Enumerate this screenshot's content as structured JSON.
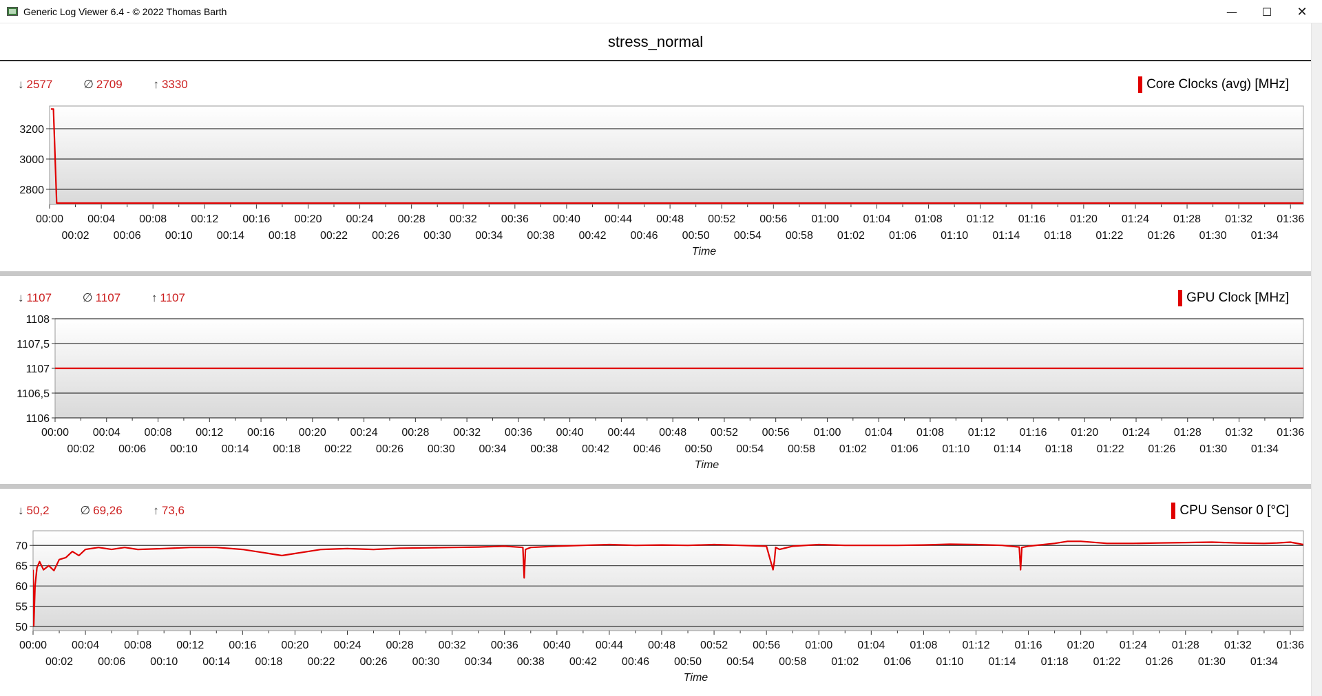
{
  "window": {
    "title": "Generic Log Viewer 6.4 - © 2022 Thomas Barth",
    "min_glyph": "—",
    "max_glyph": "☐",
    "close_glyph": "✕"
  },
  "header": {
    "title": "stress_normal"
  },
  "time_ticks_top": [
    "00:00",
    "00:04",
    "00:08",
    "00:12",
    "00:16",
    "00:20",
    "00:24",
    "00:28",
    "00:32",
    "00:36",
    "00:40",
    "00:44",
    "00:48",
    "00:52",
    "00:56",
    "01:00",
    "01:04",
    "01:08",
    "01:12",
    "01:16",
    "01:20",
    "01:24",
    "01:28",
    "01:32",
    "01:36"
  ],
  "time_ticks_bottom": [
    "00:02",
    "00:06",
    "00:10",
    "00:14",
    "00:18",
    "00:22",
    "00:26",
    "00:30",
    "00:34",
    "00:38",
    "00:42",
    "00:46",
    "00:50",
    "00:54",
    "00:58",
    "01:02",
    "01:06",
    "01:10",
    "01:14",
    "01:18",
    "01:22",
    "01:26",
    "01:30",
    "01:34"
  ],
  "colors": {
    "series": "#e00000",
    "stats": "#cc1f1f",
    "grid": "#3a3a3a"
  },
  "chart_data": [
    {
      "type": "line",
      "legend": "Core Clocks (avg) [MHz]",
      "xlabel": "Time",
      "xlim_minutes": [
        0,
        97
      ],
      "ylim": [
        2700,
        3350
      ],
      "y_ticks": [
        3200,
        3000,
        2800
      ],
      "y_tick_labels": [
        "3200",
        "3000",
        "2800"
      ],
      "stats": {
        "min": "2577",
        "avg": "2709",
        "max": "3330"
      },
      "series": [
        {
          "x_minutes": [
            0.1,
            0.3,
            0.55,
            97
          ],
          "values": [
            3330,
            3330,
            2709,
            2709
          ]
        }
      ]
    },
    {
      "type": "line",
      "legend": "GPU Clock [MHz]",
      "xlabel": "Time",
      "xlim_minutes": [
        0,
        97
      ],
      "ylim": [
        1106,
        1108
      ],
      "y_ticks": [
        1108,
        1107.5,
        1107,
        1106.5,
        1106
      ],
      "y_tick_labels": [
        "1108",
        "1107,5",
        "1107",
        "1106,5",
        "1106"
      ],
      "stats": {
        "min": "1107",
        "avg": "1107",
        "max": "1107"
      },
      "series": [
        {
          "x_minutes": [
            0,
            97
          ],
          "values": [
            1107,
            1107
          ]
        }
      ]
    },
    {
      "type": "line",
      "legend": "CPU Sensor 0 [°C]",
      "xlabel": "Time",
      "xlim_minutes": [
        0,
        97
      ],
      "ylim": [
        49,
        73.6
      ],
      "y_ticks": [
        70,
        65,
        60,
        55,
        50
      ],
      "y_tick_labels": [
        "70",
        "65",
        "60",
        "55",
        "50"
      ],
      "stats": {
        "min": "50,2",
        "avg": "69,26",
        "max": "73,6"
      },
      "series": [
        {
          "x_minutes": [
            0.0,
            0.05,
            0.15,
            0.3,
            0.5,
            0.8,
            1.2,
            1.6,
            2.0,
            2.5,
            3.0,
            3.5,
            4.0,
            5.0,
            6.0,
            7.0,
            8.0,
            10.0,
            12.0,
            14.0,
            16.0,
            18.0,
            19.0,
            20.0,
            21.0,
            22.0,
            24.0,
            26.0,
            28.0,
            30.0,
            32.0,
            34.0,
            36.0,
            37.4,
            37.5,
            37.6,
            38.0,
            40.0,
            42.0,
            44.0,
            46.0,
            48.0,
            50.0,
            52.0,
            54.0,
            56.0,
            56.5,
            56.6,
            56.7,
            57.0,
            58.0,
            60.0,
            62.0,
            64.0,
            66.0,
            68.0,
            70.0,
            72.0,
            74.0,
            75.3,
            75.4,
            75.5,
            76.0,
            78.0,
            79.0,
            80.0,
            82.0,
            84.0,
            86.0,
            88.0,
            90.0,
            92.0,
            94.0,
            95.0,
            96.0,
            97.0
          ],
          "values": [
            64.0,
            50.2,
            60.0,
            64.5,
            66.0,
            64.0,
            65.0,
            63.8,
            66.5,
            67.0,
            68.5,
            67.5,
            69.0,
            69.5,
            69.0,
            69.5,
            69.0,
            69.2,
            69.5,
            69.5,
            69.0,
            68.0,
            67.5,
            68.0,
            68.5,
            69.0,
            69.2,
            69.0,
            69.3,
            69.4,
            69.5,
            69.6,
            69.8,
            69.5,
            62.0,
            69.0,
            69.5,
            69.8,
            70.0,
            70.2,
            70.0,
            70.1,
            70.0,
            70.2,
            70.0,
            69.8,
            64.0,
            66.0,
            69.5,
            69.0,
            69.8,
            70.2,
            70.0,
            70.0,
            70.0,
            70.1,
            70.3,
            70.2,
            70.0,
            69.6,
            64.0,
            69.5,
            69.8,
            70.5,
            71.0,
            71.0,
            70.5,
            70.5,
            70.6,
            70.7,
            70.8,
            70.6,
            70.5,
            70.6,
            70.8,
            70.2
          ]
        }
      ]
    }
  ]
}
